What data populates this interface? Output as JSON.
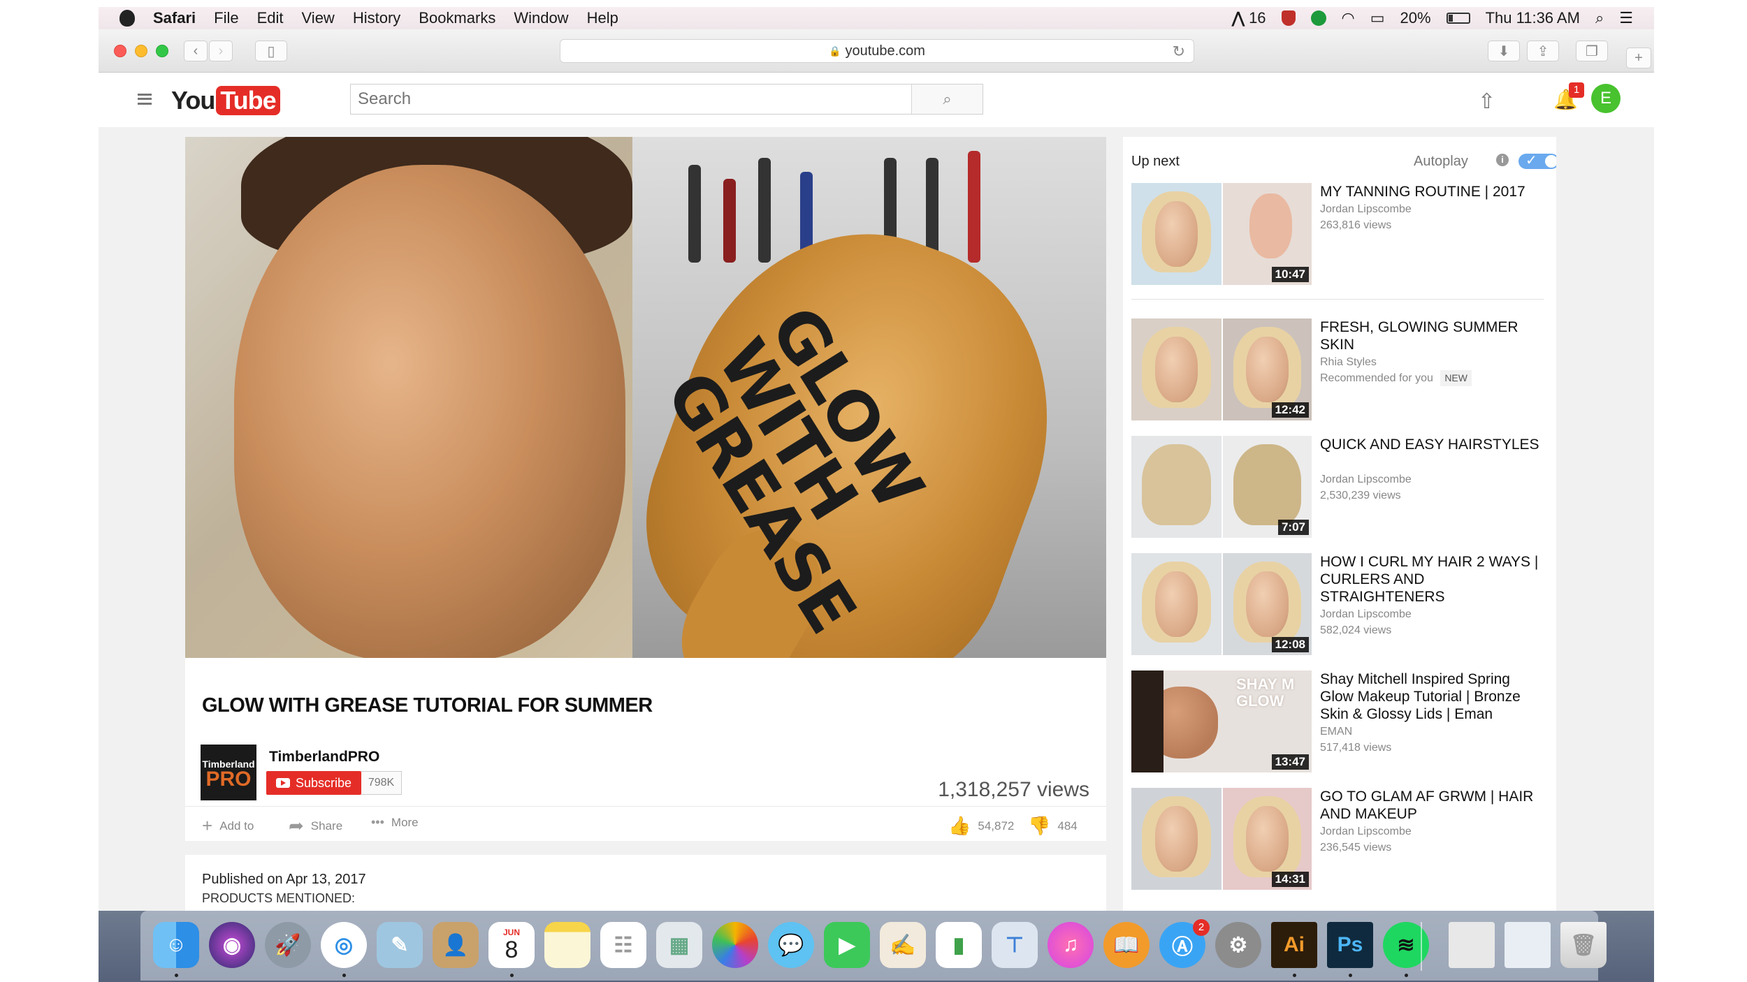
{
  "menubar": {
    "app": "Safari",
    "items": [
      "File",
      "Edit",
      "View",
      "History",
      "Bookmarks",
      "Window",
      "Help"
    ],
    "status_count": "16",
    "battery": "20%",
    "clock": "Thu 11:36 AM"
  },
  "browser": {
    "url": "youtube.com"
  },
  "youtube": {
    "logo_you": "You",
    "logo_tube": "Tube",
    "search_placeholder": "Search",
    "notification_count": "1",
    "avatar_letter": "E"
  },
  "video": {
    "overlay_text": "GLOW WITH GREASE",
    "title": "GLOW WITH GREASE TUTORIAL FOR SUMMER",
    "channel": "TimberlandPRO",
    "channel_logo_top": "Timberland",
    "channel_logo_bottom": "PRO",
    "subscribe_label": "Subscribe",
    "subscriber_count": "798K",
    "views": "1,318,257 views",
    "add_to_label": "Add to",
    "share_label": "Share",
    "more_label": "More",
    "likes": "54,872",
    "dislikes": "484",
    "published": "Published on Apr 13, 2017",
    "mentioned": "PRODUCTS MENTIONED:"
  },
  "sidebar": {
    "up_next": "Up next",
    "autoplay": "Autoplay",
    "items": [
      {
        "title": "MY TANNING ROUTINE | 2017",
        "channel": "Jordan Lipscombe",
        "meta": "263,816 views",
        "duration": "10:47"
      },
      {
        "title": "FRESH, GLOWING SUMMER SKIN",
        "channel": "Rhia Styles",
        "meta": "Recommended for you",
        "badge": "NEW",
        "duration": "12:42"
      },
      {
        "title": "QUICK AND EASY HAIRSTYLES",
        "channel": "Jordan Lipscombe",
        "meta": "2,530,239 views",
        "duration": "7:07"
      },
      {
        "title": "HOW I CURL MY HAIR 2 WAYS | CURLERS AND STRAIGHTENERS",
        "channel": "Jordan Lipscombe",
        "meta": "582,024 views",
        "duration": "12:08"
      },
      {
        "title": "Shay Mitchell Inspired Spring Glow Makeup Tutorial | Bronze Skin & Glossy Lids | Eman",
        "channel": "EMAN",
        "meta": "517,418 views",
        "duration": "13:47",
        "thumb_text": "SHAY M GLOW"
      },
      {
        "title": "GO TO GLAM AF GRWM | HAIR AND MAKEUP",
        "channel": "Jordan Lipscombe",
        "meta": "236,545 views",
        "duration": "14:31"
      }
    ]
  },
  "dock": {
    "calendar_month": "JUN",
    "calendar_day": "8",
    "appstore_badge": "2",
    "illustrator_label": "Ai",
    "photoshop_label": "Ps"
  },
  "colors": {
    "youtube_red": "#e52d27",
    "link_blue": "#2793e6",
    "avatar_green": "#48c22e"
  }
}
